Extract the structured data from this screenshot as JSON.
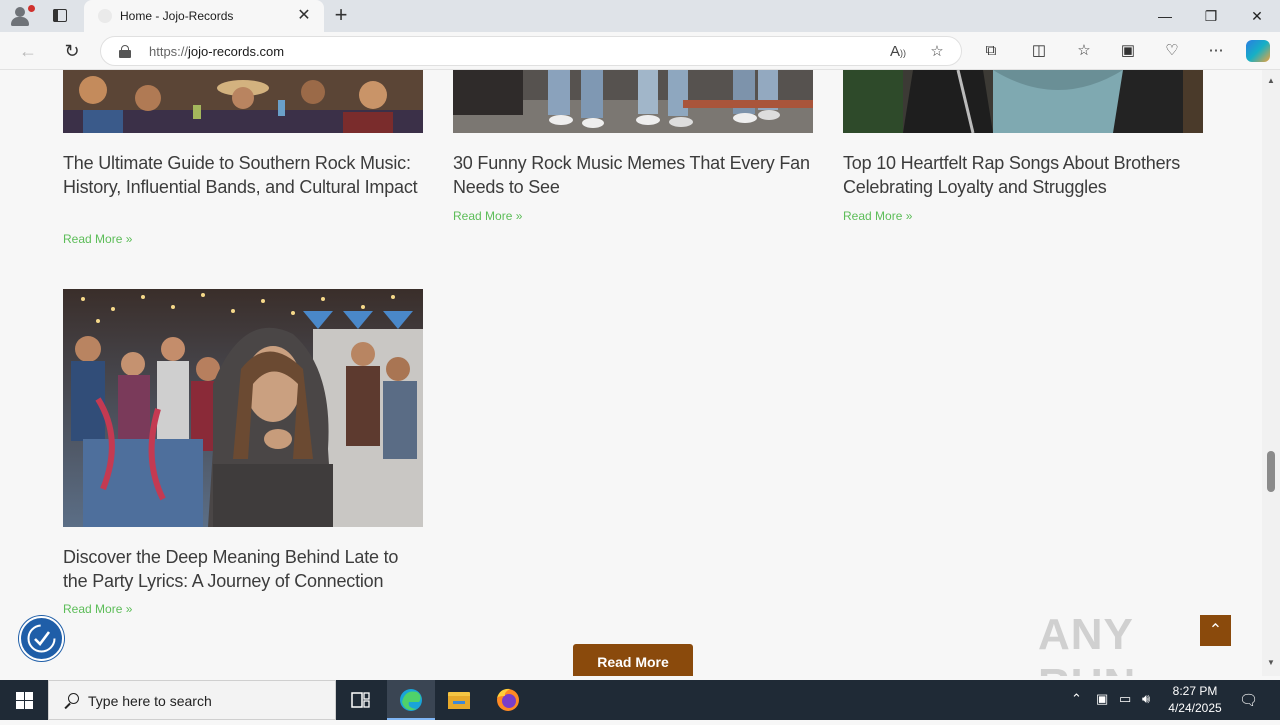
{
  "browser": {
    "tab_title": "Home - Jojo-Records",
    "url_protocol": "https://",
    "url_host": "jojo-records.com",
    "window_controls": {
      "minimize": "—",
      "restore": "❐",
      "close": "✕"
    }
  },
  "posts": [
    {
      "title": "The Ultimate Guide to Southern Rock Music: History, Influential Bands, and Cultural Impact",
      "read_more": "Read More »"
    },
    {
      "title": "30 Funny Rock Music Memes That Every Fan Needs to See",
      "read_more": "Read More »"
    },
    {
      "title": "Top 10 Heartfelt Rap Songs About Brothers Celebrating Loyalty and Struggles",
      "read_more": "Read More »"
    },
    {
      "title": "Discover the Deep Meaning Behind Late to the Party Lyrics: A Journey of Connection",
      "read_more": "Read More »"
    }
  ],
  "load_more_label": "Read More",
  "watermark": "ANY RUN",
  "taskbar": {
    "search_placeholder": "Type here to search",
    "time": "8:27 PM",
    "date": "4/24/2025"
  },
  "colors": {
    "accent_brown": "#8a4a0c",
    "read_more_green": "#5cbd58",
    "accessibility_blue": "#1f5ea8"
  }
}
